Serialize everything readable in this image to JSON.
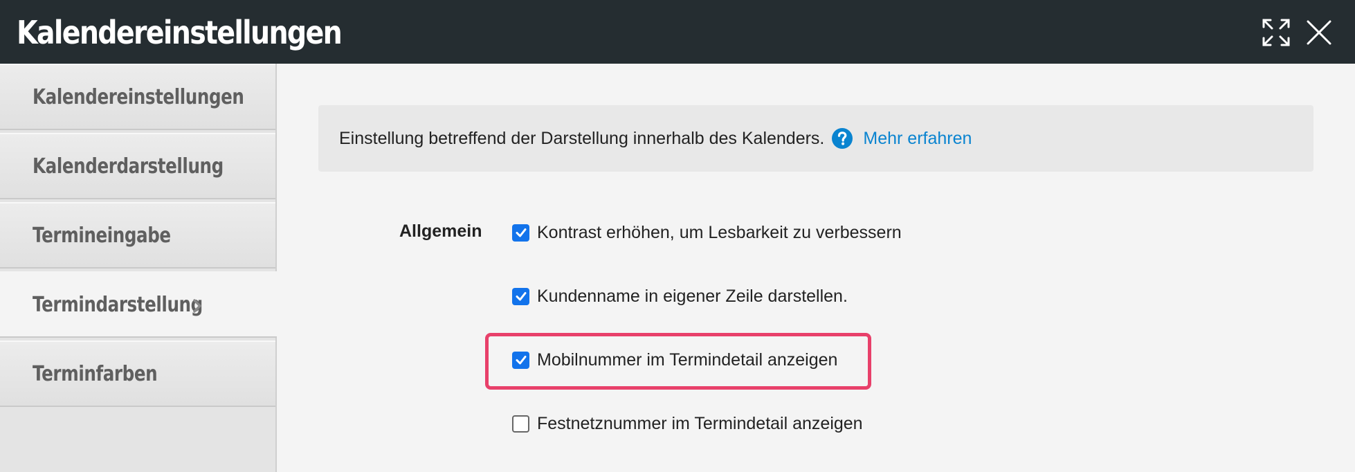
{
  "window": {
    "title": "Kalendereinstellungen",
    "expand_icon": "expand-icon",
    "close_icon": "close-icon"
  },
  "sidebar": {
    "items": [
      {
        "label": "Kalendereinstellungen",
        "active": false
      },
      {
        "label": "Kalenderdarstellung",
        "active": false
      },
      {
        "label": "Termineingabe",
        "active": false
      },
      {
        "label": "Termindarstellung",
        "active": true
      },
      {
        "label": "Terminfarben",
        "active": false
      }
    ]
  },
  "info": {
    "text": "Einstellung betreffend der Darstellung innerhalb des Kalenders.",
    "help_icon": "question-circle-icon",
    "link": "Mehr erfahren"
  },
  "settings": {
    "section_label": "Allgemein",
    "options": [
      {
        "label": "Kontrast erhöhen, um Lesbarkeit zu verbessern",
        "checked": true
      },
      {
        "label": "Kundenname in eigener Zeile darstellen.",
        "checked": true
      },
      {
        "label": "Mobilnummer im Termindetail anzeigen",
        "checked": true,
        "highlighted": true
      },
      {
        "label": "Festnetznummer im Termindetail anzeigen",
        "checked": false
      }
    ]
  },
  "colors": {
    "titlebar": "#252d31",
    "checkbox": "#1273eb",
    "link": "#0a84d0",
    "highlight": "#e8406a"
  }
}
